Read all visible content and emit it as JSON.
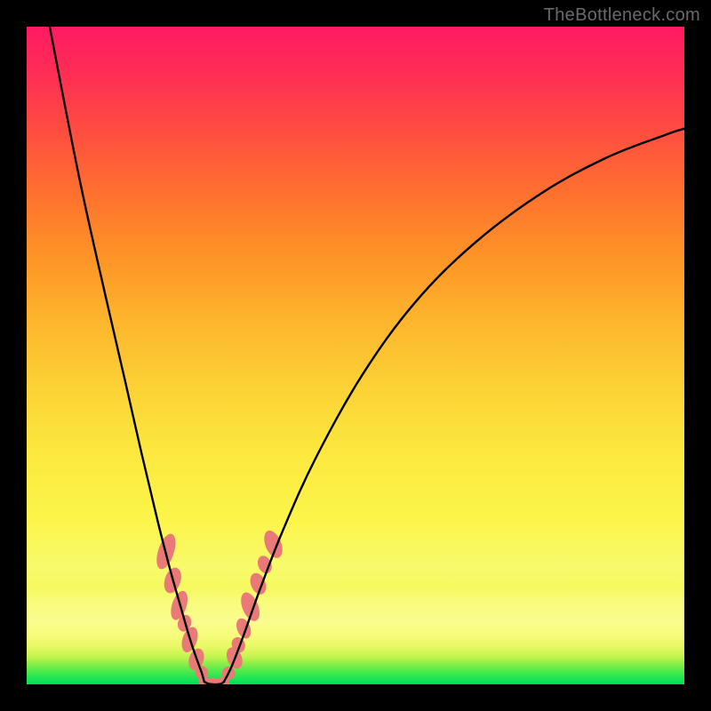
{
  "watermark": "TheBottleneck.com",
  "colors": {
    "bead": "#ea7a78",
    "curve": "#000000"
  },
  "chart_data": {
    "type": "line",
    "title": "",
    "xlabel": "",
    "ylabel": "",
    "xlim": [
      0,
      1
    ],
    "ylim": [
      0,
      1
    ],
    "notes": "Two curves forming a V shape with coral bead markers clustered near the valley. Background is a vertical heat-map gradient from green (bottom) through yellow/orange to pink (top). Values are geometric estimates read from the image; no numeric axes are shown.",
    "series": [
      {
        "name": "left-curve",
        "x": [
          0.035,
          0.08,
          0.12,
          0.15,
          0.175,
          0.2,
          0.218,
          0.235,
          0.248,
          0.258,
          0.266,
          0.27
        ],
        "values": [
          1.0,
          0.77,
          0.59,
          0.46,
          0.35,
          0.245,
          0.175,
          0.115,
          0.07,
          0.04,
          0.018,
          0.004
        ]
      },
      {
        "name": "right-curve",
        "x": [
          0.3,
          0.312,
          0.33,
          0.355,
          0.39,
          0.44,
          0.51,
          0.59,
          0.68,
          0.78,
          0.88,
          0.97,
          1.0
        ],
        "values": [
          0.004,
          0.028,
          0.075,
          0.145,
          0.235,
          0.345,
          0.47,
          0.58,
          0.67,
          0.745,
          0.8,
          0.835,
          0.845
        ]
      },
      {
        "name": "valley-floor",
        "x": [
          0.27,
          0.276,
          0.283,
          0.29,
          0.296,
          0.3
        ],
        "values": [
          0.004,
          0.001,
          0.0,
          0.0,
          0.001,
          0.004
        ]
      }
    ],
    "beads_left": [
      {
        "x": 0.212,
        "y": 0.202,
        "rx": 0.012,
        "ry": 0.028
      },
      {
        "x": 0.222,
        "y": 0.158,
        "rx": 0.012,
        "ry": 0.02
      },
      {
        "x": 0.232,
        "y": 0.12,
        "rx": 0.011,
        "ry": 0.023
      },
      {
        "x": 0.24,
        "y": 0.093,
        "rx": 0.01,
        "ry": 0.013
      },
      {
        "x": 0.248,
        "y": 0.068,
        "rx": 0.011,
        "ry": 0.02
      },
      {
        "x": 0.258,
        "y": 0.038,
        "rx": 0.011,
        "ry": 0.017
      },
      {
        "x": 0.266,
        "y": 0.018,
        "rx": 0.01,
        "ry": 0.01
      }
    ],
    "beads_right": [
      {
        "x": 0.307,
        "y": 0.017,
        "rx": 0.01,
        "ry": 0.01
      },
      {
        "x": 0.316,
        "y": 0.04,
        "rx": 0.011,
        "ry": 0.017
      },
      {
        "x": 0.322,
        "y": 0.06,
        "rx": 0.01,
        "ry": 0.012
      },
      {
        "x": 0.33,
        "y": 0.085,
        "rx": 0.01,
        "ry": 0.016
      },
      {
        "x": 0.34,
        "y": 0.118,
        "rx": 0.012,
        "ry": 0.023
      },
      {
        "x": 0.352,
        "y": 0.153,
        "rx": 0.011,
        "ry": 0.017
      },
      {
        "x": 0.362,
        "y": 0.182,
        "rx": 0.01,
        "ry": 0.014
      },
      {
        "x": 0.375,
        "y": 0.213,
        "rx": 0.012,
        "ry": 0.022
      }
    ],
    "beads_floor": [
      {
        "x": 0.27,
        "y": 0.004,
        "rx": 0.009,
        "ry": 0.009
      },
      {
        "x": 0.284,
        "y": 0.001,
        "rx": 0.01,
        "ry": 0.009
      },
      {
        "x": 0.298,
        "y": 0.002,
        "rx": 0.01,
        "ry": 0.009
      }
    ]
  }
}
